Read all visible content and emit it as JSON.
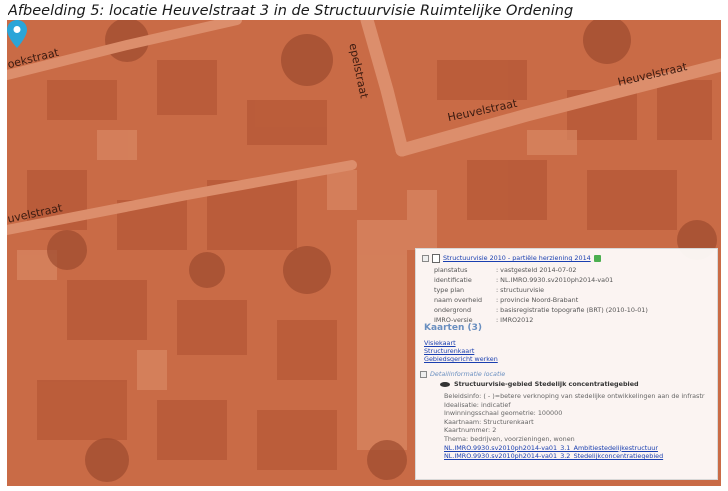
{
  "caption": "Afbeelding 5: locatie Heuvelstraat 3 in de Structuurvisie Ruimtelijke Ordening",
  "colors": {
    "overlay": "#c86a45",
    "link": "#1a3fb0",
    "marker": "#2aa5d8"
  },
  "map": {
    "streets": [
      {
        "id": "boekstraat",
        "label": "oekstraat"
      },
      {
        "id": "pelstraat",
        "label": "epelstraat"
      },
      {
        "id": "heuvelstraat-east",
        "label": "Heuvelstraat"
      },
      {
        "id": "heuvelstraat-mid",
        "label": "Heuvelstraat"
      },
      {
        "id": "heuvelstraat-west",
        "label": "uvelstraat"
      }
    ],
    "marker_icon": "location-pin-icon"
  },
  "panel": {
    "title": "Structuurvisie 2010 - partiële herziening 2014",
    "meta": [
      {
        "key": "planstatus",
        "value": ": vastgesteld 2014-07-02"
      },
      {
        "key": "identificatie",
        "value": ": NL.IMRO.9930.sv2010ph2014-va01"
      },
      {
        "key": "type plan",
        "value": ": structuurvisie"
      },
      {
        "key": "naam overheid",
        "value": ": provincie Noord-Brabant"
      },
      {
        "key": "ondergrond",
        "value": ": basisregistratie topografie (BRT) (2010-10-01)"
      },
      {
        "key": "IMRO-versie",
        "value": ": IMRO2012"
      }
    ],
    "kaarten_heading": "Kaarten (3)",
    "kaarten": [
      "Visiekaart",
      "Structurenkaart",
      "Gebiedsgericht werken"
    ],
    "detail_heading": "Detailinformatie locatie",
    "detail_title": "Structuurvisie-gebied Stedelijk concentratiegebied",
    "detail_lines": [
      "Beleidsinfo: ( - )=betere verknoping van stedelijke ontwikkelingen aan de infrastr",
      "Idealisatie: indicatief",
      "Inwinningsschaal geometrie: 100000",
      "Kaartnaam: Structurenkaart",
      "Kaartnummer: 2",
      "Thema: bedrijven, voorzieningen, wonen"
    ],
    "detail_links": [
      "NL.IMRO.9930.sv2010ph2014-va01_3.1_Ambitiestedelijkestructuur",
      "NL.IMRO.9930.sv2010ph2014-va01_3.2_Stedelijkconcentratiegebied"
    ]
  }
}
